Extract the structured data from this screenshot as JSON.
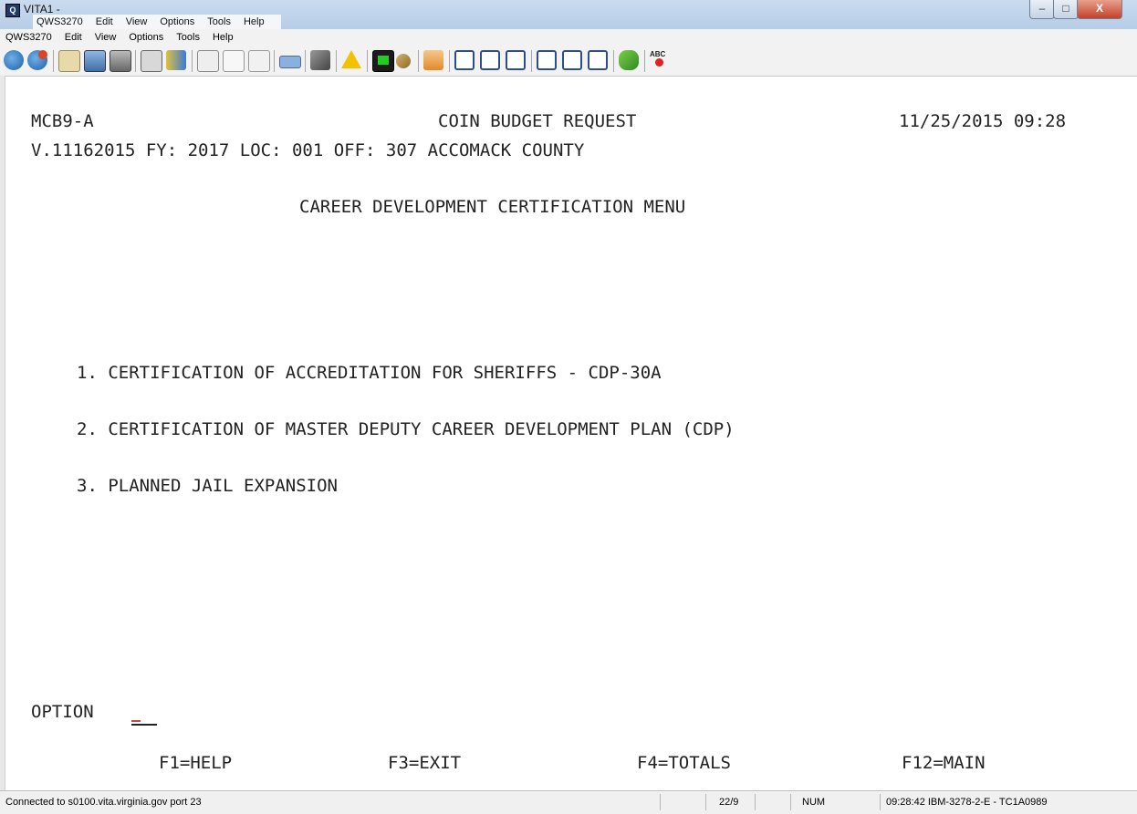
{
  "window": {
    "title": "VITA1 - ",
    "overlay_menu": [
      "QWS3270",
      "Edit",
      "View",
      "Options",
      "Tools",
      "Help"
    ],
    "close_label": "X"
  },
  "menubar": [
    "QWS3270",
    "Edit",
    "View",
    "Options",
    "Tools",
    "Help"
  ],
  "toolbar_icons": [
    "connect-icon",
    "disconnect-icon",
    "money-icon",
    "screen-capture-icon",
    "print-icon",
    "snapshot-icon",
    "transfer-icon",
    "cut-icon",
    "copy-icon",
    "paste-icon",
    "keyboard-icon",
    "macro-icon",
    "warning-icon",
    "terminal-icon",
    "wrench-icon",
    "home-icon",
    "enter-icon",
    "field-icon",
    "tab-icon",
    "r1-icon",
    "r2-icon",
    "r3-icon",
    "script-icon",
    "spellcheck-icon"
  ],
  "terminal": {
    "screen_id": "MCB9-A",
    "app_title": "COIN BUDGET REQUEST",
    "datetime": "11/25/2015 09:28",
    "context_line": "V.11162015 FY: 2017 LOC: 001 OFF: 307 ACCOMACK COUNTY",
    "menu_title": "CAREER DEVELOPMENT CERTIFICATION MENU",
    "options": [
      "1. CERTIFICATION OF ACCREDITATION FOR SHERIFFS - CDP-30A",
      "2. CERTIFICATION OF MASTER DEPUTY CAREER DEVELOPMENT PLAN (CDP)",
      "3. PLANNED JAIL EXPANSION"
    ],
    "option_label": "OPTION",
    "option_value": "",
    "function_keys": [
      "F1=HELP",
      "F3=EXIT",
      "F4=TOTALS",
      "F12=MAIN"
    ]
  },
  "status": {
    "connection": "Connected to s0100.vita.virginia.gov port 23",
    "cursor_pos": "22/9",
    "num": "NUM",
    "session": "09:28:42 IBM-3278-2-E - TC1A0989"
  }
}
